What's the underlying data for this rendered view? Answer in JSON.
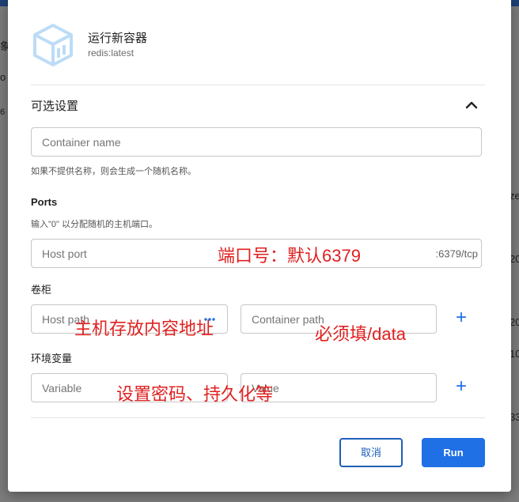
{
  "background": {
    "left_fragments": [
      "象",
      "o",
      "6"
    ],
    "right_fragments": [
      "ze",
      "20",
      "20",
      "10",
      "33"
    ]
  },
  "dialog": {
    "title": "运行新容器",
    "image": "redis:latest",
    "icon": "cube-icon",
    "optional_section": {
      "title": "可选设置",
      "toggle_icon": "chevron-up-icon"
    },
    "container_name": {
      "placeholder": "Container name",
      "hint": "如果不提供名称，则会生成一个随机名称。"
    },
    "ports": {
      "title": "Ports",
      "hint": "输入\"0\" 以分配随机的主机端口。",
      "host_port_placeholder": "Host port",
      "container_port": ":6379/tcp"
    },
    "volumes": {
      "title": "卷柜",
      "host_path_placeholder": "Host path",
      "container_path_placeholder": "Container path",
      "add_icon": "+"
    },
    "env": {
      "title": "环境变量",
      "variable_placeholder": "Variable",
      "value_placeholder": "Value",
      "add_icon": "+"
    },
    "buttons": {
      "cancel": "取消",
      "run": "Run"
    }
  },
  "annotations": {
    "port_note": "端口号：默认6379",
    "host_path_note": "主机存放内容地址",
    "container_path_note": "必须填/data",
    "env_note": "设置密码、持久化等"
  },
  "colors": {
    "primary": "#1f6fe5",
    "annotation": "#e02020",
    "topbar": "#1f3f73"
  }
}
